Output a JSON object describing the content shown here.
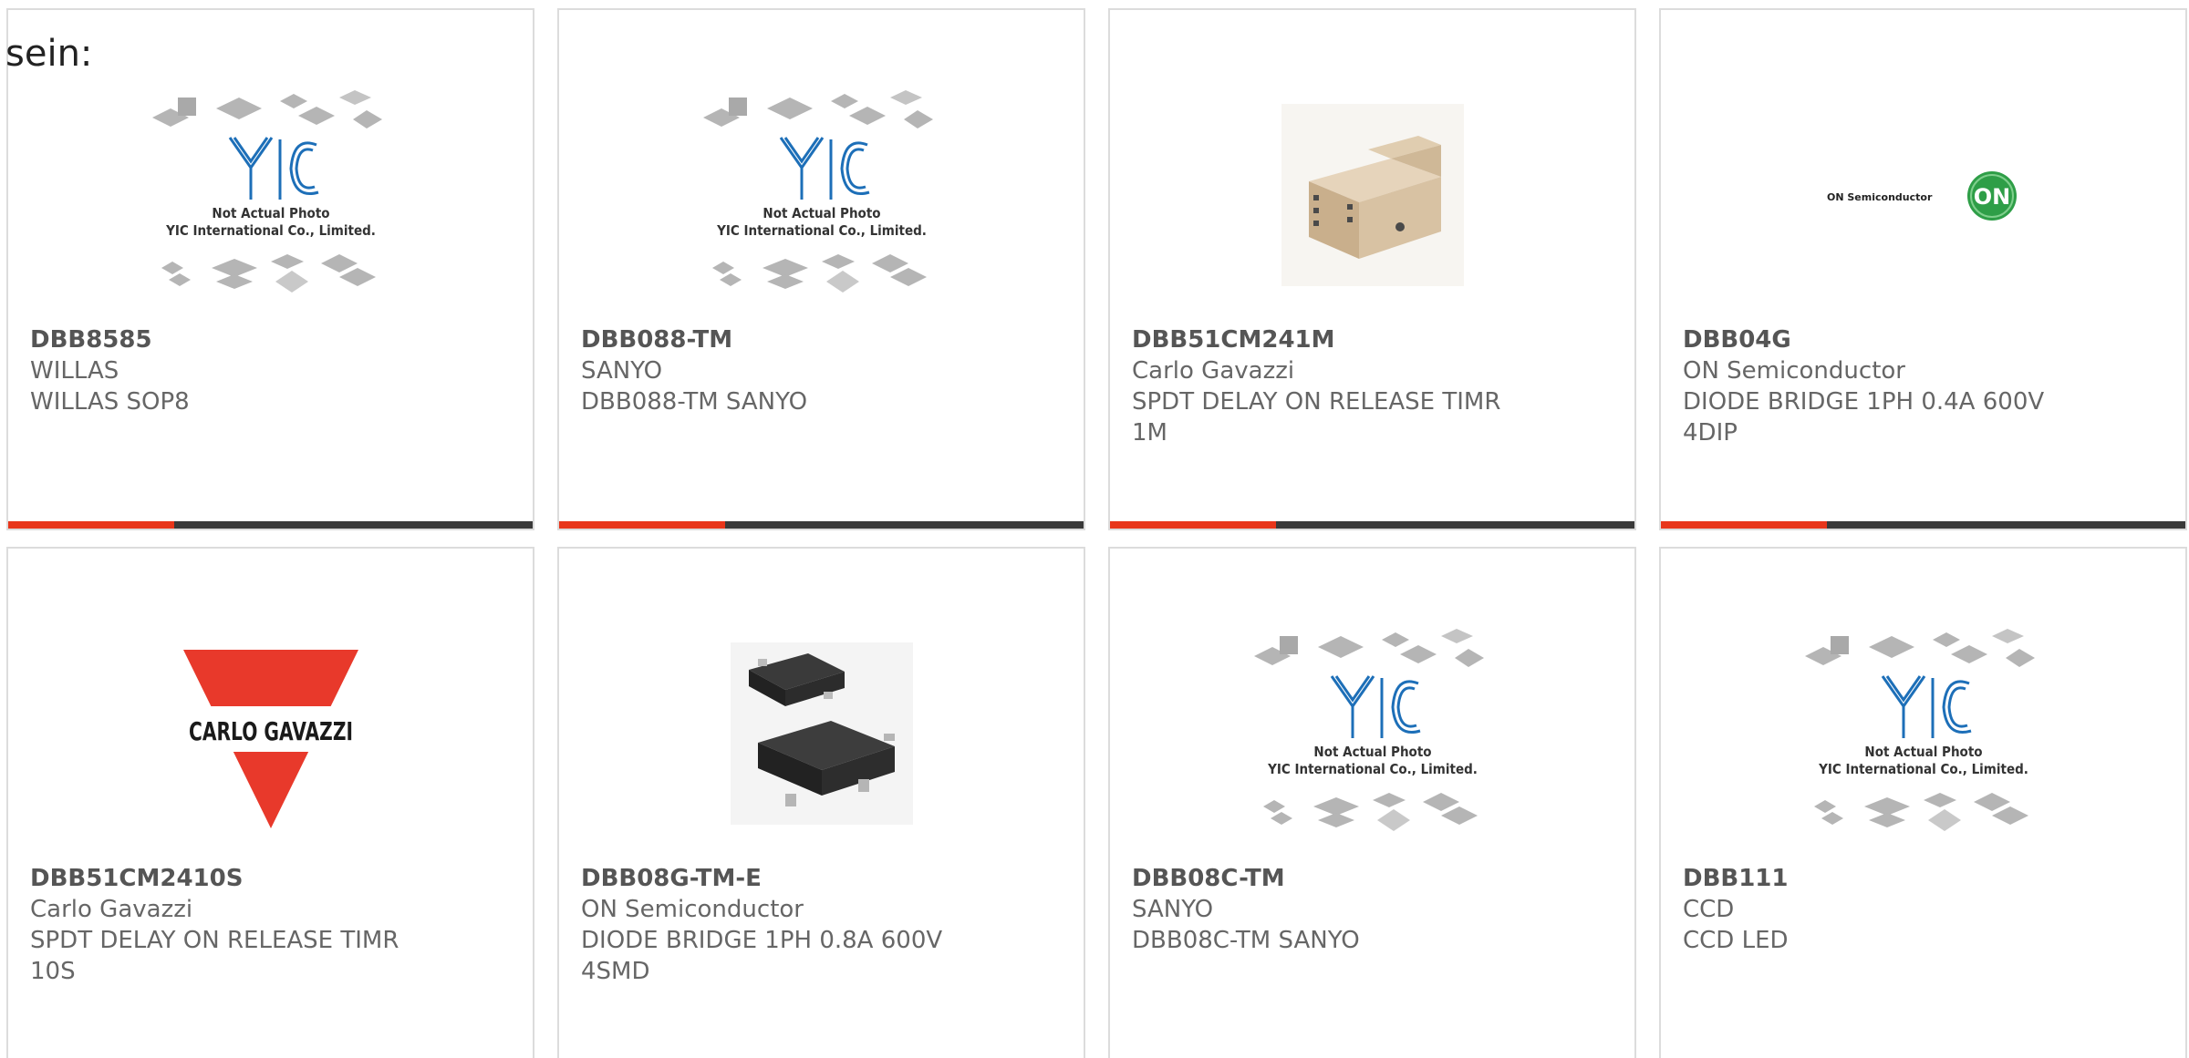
{
  "intro_text": "sein:",
  "placeholder_image": {
    "line1": "Not Actual Photo",
    "line2": "YIC International Co., Limited."
  },
  "logos": {
    "on_semi_text": "ON Semiconductor",
    "on_badge": "ON",
    "carlo_gavazzi": "CARLO GAVAZZI"
  },
  "colors": {
    "accent": "#e8361b",
    "bar": "#3a3a3a",
    "text": "#666666"
  },
  "products": [
    {
      "part": "DBB8585",
      "manufacturer": "WILLAS",
      "description": "WILLAS SOP8",
      "image": "yic-placeholder"
    },
    {
      "part": "DBB088-TM",
      "manufacturer": "SANYO",
      "description": "DBB088-TM SANYO",
      "image": "yic-placeholder"
    },
    {
      "part": "DBB51CM241M",
      "manufacturer": "Carlo Gavazzi",
      "description": "SPDT DELAY ON RELEASE TIMR 1M",
      "image": "relay-module-photo"
    },
    {
      "part": "DBB04G",
      "manufacturer": "ON Semiconductor",
      "description": "DIODE BRIDGE 1PH 0.4A 600V 4DIP",
      "image": "on-semiconductor-logo"
    },
    {
      "part": "DBB51CM2410S",
      "manufacturer": "Carlo Gavazzi",
      "description": "SPDT DELAY ON RELEASE TIMR 10S",
      "image": "carlo-gavazzi-logo"
    },
    {
      "part": "DBB08G-TM-E",
      "manufacturer": "ON Semiconductor",
      "description": "DIODE BRIDGE 1PH 0.8A 600V 4SMD",
      "image": "smd-bridge-photo"
    },
    {
      "part": "DBB08C-TM",
      "manufacturer": "SANYO",
      "description": "DBB08C-TM SANYO",
      "image": "yic-placeholder"
    },
    {
      "part": "DBB111",
      "manufacturer": "CCD",
      "description": "CCD LED",
      "image": "yic-placeholder"
    }
  ]
}
